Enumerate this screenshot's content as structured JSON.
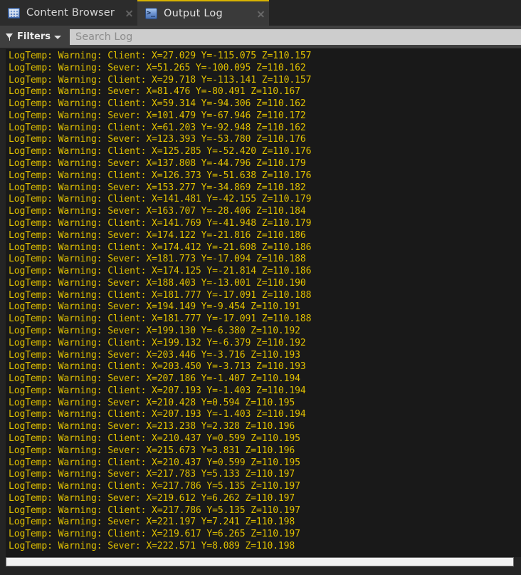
{
  "window": {
    "tabs": [
      {
        "label": "Content Browser",
        "icon": "content-browser-icon",
        "active": false
      },
      {
        "label": "Output Log",
        "icon": "console-icon",
        "active": true
      }
    ]
  },
  "toolbar": {
    "filters_label": "Filters",
    "filter_icon": "funnel-icon",
    "caret_icon": "chevron-down-icon",
    "search_placeholder": "Search Log",
    "search_value": ""
  },
  "colors": {
    "log_text": "#e0c000",
    "log_background": "#191919",
    "tab_active_accent": "#d9b300",
    "toolbar_background": "#3f3f3f"
  },
  "log": {
    "lines": [
      "LogTemp: Warning: Client: X=27.029 Y=-115.075 Z=110.157",
      "LogTemp: Warning: Sever: X=51.265 Y=-100.095 Z=110.162",
      "LogTemp: Warning: Client: X=29.718 Y=-113.141 Z=110.157",
      "LogTemp: Warning: Sever: X=81.476 Y=-80.491 Z=110.167",
      "LogTemp: Warning: Client: X=59.314 Y=-94.306 Z=110.162",
      "LogTemp: Warning: Sever: X=101.479 Y=-67.946 Z=110.172",
      "LogTemp: Warning: Client: X=61.203 Y=-92.948 Z=110.162",
      "LogTemp: Warning: Sever: X=123.393 Y=-53.780 Z=110.176",
      "LogTemp: Warning: Client: X=125.285 Y=-52.420 Z=110.176",
      "LogTemp: Warning: Sever: X=137.808 Y=-44.796 Z=110.179",
      "LogTemp: Warning: Client: X=126.373 Y=-51.638 Z=110.176",
      "LogTemp: Warning: Sever: X=153.277 Y=-34.869 Z=110.182",
      "LogTemp: Warning: Client: X=141.481 Y=-42.155 Z=110.179",
      "LogTemp: Warning: Sever: X=163.707 Y=-28.406 Z=110.184",
      "LogTemp: Warning: Client: X=141.769 Y=-41.948 Z=110.179",
      "LogTemp: Warning: Sever: X=174.122 Y=-21.816 Z=110.186",
      "LogTemp: Warning: Client: X=174.412 Y=-21.608 Z=110.186",
      "LogTemp: Warning: Sever: X=181.773 Y=-17.094 Z=110.188",
      "LogTemp: Warning: Client: X=174.125 Y=-21.814 Z=110.186",
      "LogTemp: Warning: Sever: X=188.403 Y=-13.001 Z=110.190",
      "LogTemp: Warning: Client: X=181.777 Y=-17.091 Z=110.188",
      "LogTemp: Warning: Sever: X=194.149 Y=-9.454 Z=110.191",
      "LogTemp: Warning: Client: X=181.777 Y=-17.091 Z=110.188",
      "LogTemp: Warning: Sever: X=199.130 Y=-6.380 Z=110.192",
      "LogTemp: Warning: Client: X=199.132 Y=-6.379 Z=110.192",
      "LogTemp: Warning: Sever: X=203.446 Y=-3.716 Z=110.193",
      "LogTemp: Warning: Client: X=203.450 Y=-3.713 Z=110.193",
      "LogTemp: Warning: Sever: X=207.186 Y=-1.407 Z=110.194",
      "LogTemp: Warning: Client: X=207.193 Y=-1.403 Z=110.194",
      "LogTemp: Warning: Sever: X=210.428 Y=0.594 Z=110.195",
      "LogTemp: Warning: Client: X=207.193 Y=-1.403 Z=110.194",
      "LogTemp: Warning: Sever: X=213.238 Y=2.328 Z=110.196",
      "LogTemp: Warning: Client: X=210.437 Y=0.599 Z=110.195",
      "LogTemp: Warning: Sever: X=215.673 Y=3.831 Z=110.196",
      "LogTemp: Warning: Client: X=210.437 Y=0.599 Z=110.195",
      "LogTemp: Warning: Sever: X=217.783 Y=5.133 Z=110.197",
      "LogTemp: Warning: Client: X=217.786 Y=5.135 Z=110.197",
      "LogTemp: Warning: Sever: X=219.612 Y=6.262 Z=110.197",
      "LogTemp: Warning: Client: X=217.786 Y=5.135 Z=110.197",
      "LogTemp: Warning: Sever: X=221.197 Y=7.241 Z=110.198",
      "LogTemp: Warning: Client: X=219.617 Y=6.265 Z=110.197",
      "LogTemp: Warning: Sever: X=222.571 Y=8.089 Z=110.198"
    ]
  }
}
